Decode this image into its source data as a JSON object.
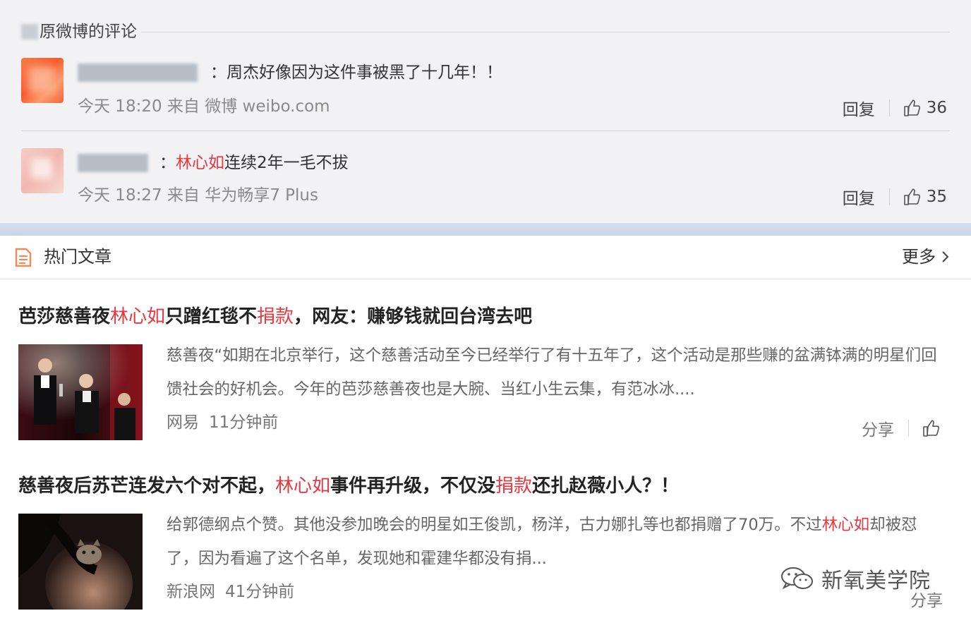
{
  "comments_section": {
    "header": "原微博的评论",
    "items": [
      {
        "text_parts": [
          {
            "t": "：周杰好像因为这件事被黑了十几年！！",
            "red": false
          }
        ],
        "meta": "今天 18:20 来自 微博 weibo.com",
        "reply": "回复",
        "likes": "36"
      },
      {
        "text_parts": [
          {
            "t": "：",
            "red": false
          },
          {
            "t": "林心如",
            "red": true
          },
          {
            "t": "连续2年一毛不拔",
            "red": false
          }
        ],
        "meta": "今天 18:27 来自 华为畅享7 Plus",
        "reply": "回复",
        "likes": "35"
      }
    ]
  },
  "hot": {
    "title": "热门文章",
    "more": "更多",
    "articles": [
      {
        "title_parts": [
          {
            "t": "芭莎慈善夜",
            "red": false
          },
          {
            "t": "林心如",
            "red": true
          },
          {
            "t": "只蹭红毯不",
            "red": false
          },
          {
            "t": "捐款",
            "red": true
          },
          {
            "t": "，网友：赚够钱就回台湾去吧",
            "red": false
          }
        ],
        "summary_parts": [
          {
            "t": "慈善夜“如期在北京举行，这个慈善活动至今已经举行了有十五年了，这个活动是那些赚的盆满钵满的明星们回馈社会的好机会。今年的芭莎慈善夜也是大腕、当红小生云集，有范冰冰....",
            "red": false
          }
        ],
        "source": "网易",
        "time": "11分钟前",
        "share": "分享"
      },
      {
        "title_parts": [
          {
            "t": "慈善夜后苏芒连发六个对不起，",
            "red": false
          },
          {
            "t": "林心如",
            "red": true
          },
          {
            "t": "事件再升级，不仅没",
            "red": false
          },
          {
            "t": "捐款",
            "red": true
          },
          {
            "t": "还扎赵薇小人？！",
            "red": false
          }
        ],
        "summary_parts": [
          {
            "t": "给郭德纲点个赞。其他没参加晚会的明星如王俊凯，杨洋，古力娜扎等也都捐赠了70万。不过",
            "red": false
          },
          {
            "t": "林心如",
            "red": true
          },
          {
            "t": "却被怼了，因为看遍了这个名单，发现她和霍建华都没有捐...",
            "red": false
          }
        ],
        "source": "新浪网",
        "time": "41分钟前",
        "share": "分享"
      }
    ]
  },
  "watermark": "新氧美学院",
  "colors": {
    "highlight": "#e8373e",
    "comment_bg": "#f2f2f5",
    "accent_bar": "#cdd7e9"
  }
}
